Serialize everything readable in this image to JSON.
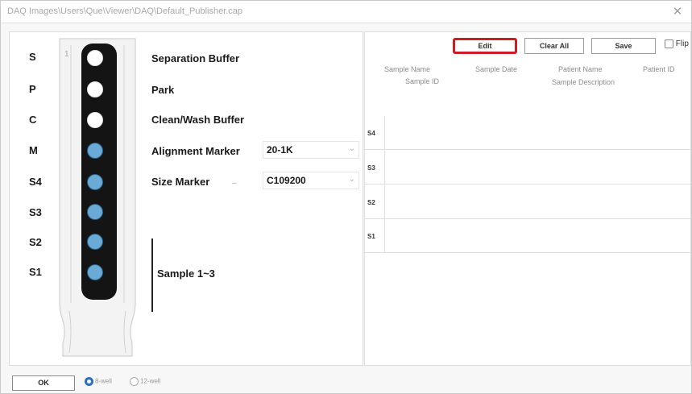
{
  "window": {
    "title": "DAQ Images\\Users\\Que\\Viewer\\DAQ\\Default_Publisher.cap",
    "close_icon": "close-icon"
  },
  "cartridge": {
    "positions": [
      {
        "label": "S",
        "dot": "white"
      },
      {
        "label": "P",
        "dot": "white"
      },
      {
        "label": "C",
        "dot": "white"
      },
      {
        "label": "M",
        "dot": "blue"
      },
      {
        "label": "S4",
        "dot": "blue"
      },
      {
        "label": "S3",
        "dot": "blue"
      },
      {
        "label": "S2",
        "dot": "blue"
      },
      {
        "label": "S1",
        "dot": "blue"
      }
    ],
    "top_marker": "1"
  },
  "labels": {
    "separation": "Separation Buffer",
    "park": "Park",
    "clean": "Clean/Wash Buffer",
    "alignment": "Alignment Marker",
    "size_marker": "Size Marker",
    "sample": "Sample 1~3"
  },
  "selects": {
    "alignment_value": "20-1K",
    "size_value": "C109200"
  },
  "toolbar": {
    "edit": "Edit",
    "clear_all": "Clear All",
    "save": "Save",
    "flip": "Flip"
  },
  "columns": {
    "sample_name": "Sample Name",
    "sample_date": "Sample Date",
    "patient_name": "Patient Name",
    "patient_id": "Patient ID",
    "sample_id": "Sample ID",
    "sample_description": "Sample Description"
  },
  "rows": [
    "S4",
    "S3",
    "S2",
    "S1"
  ],
  "footer": {
    "ok": "OK",
    "radio1": "8-well",
    "radio2": "12-well"
  },
  "colors": {
    "highlight": "#cc1d24",
    "dot_blue": "#6aaad7",
    "radio_selected": "#2a6fbf"
  }
}
